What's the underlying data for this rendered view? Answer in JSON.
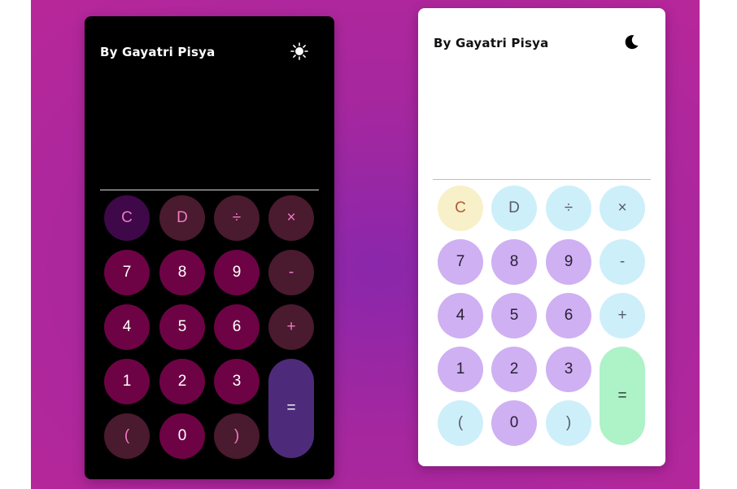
{
  "author": "By Gayatri Pisya",
  "dark_calc": {
    "theme_icon": "sun-icon",
    "display_value": "",
    "buttons": {
      "c": "C",
      "d": "D",
      "div": "÷",
      "mul": "×",
      "n7": "7",
      "n8": "8",
      "n9": "9",
      "minus": "-",
      "n4": "4",
      "n5": "5",
      "n6": "6",
      "plus": "+",
      "n1": "1",
      "n2": "2",
      "n3": "3",
      "eq": "=",
      "lparen": "(",
      "n0": "0",
      "rparen": ")"
    }
  },
  "light_calc": {
    "theme_icon": "moon-icon",
    "display_value": "",
    "buttons": {
      "c": "C",
      "d": "D",
      "div": "÷",
      "mul": "×",
      "n7": "7",
      "n8": "8",
      "n9": "9",
      "minus": "-",
      "n4": "4",
      "n5": "5",
      "n6": "6",
      "plus": "+",
      "n1": "1",
      "n2": "2",
      "n3": "3",
      "eq": "=",
      "lparen": "(",
      "n0": "0",
      "rparen": ")"
    }
  },
  "colors": {
    "background": "#a6279e",
    "dark_number": "#6d0345",
    "dark_operator": "#4a1a2f",
    "dark_equals": "#4e2a7b",
    "light_number": "#cfb0f3",
    "light_operator": "#cdeffa",
    "light_clear": "#f8f0c8",
    "light_equals": "#aef2c8"
  }
}
